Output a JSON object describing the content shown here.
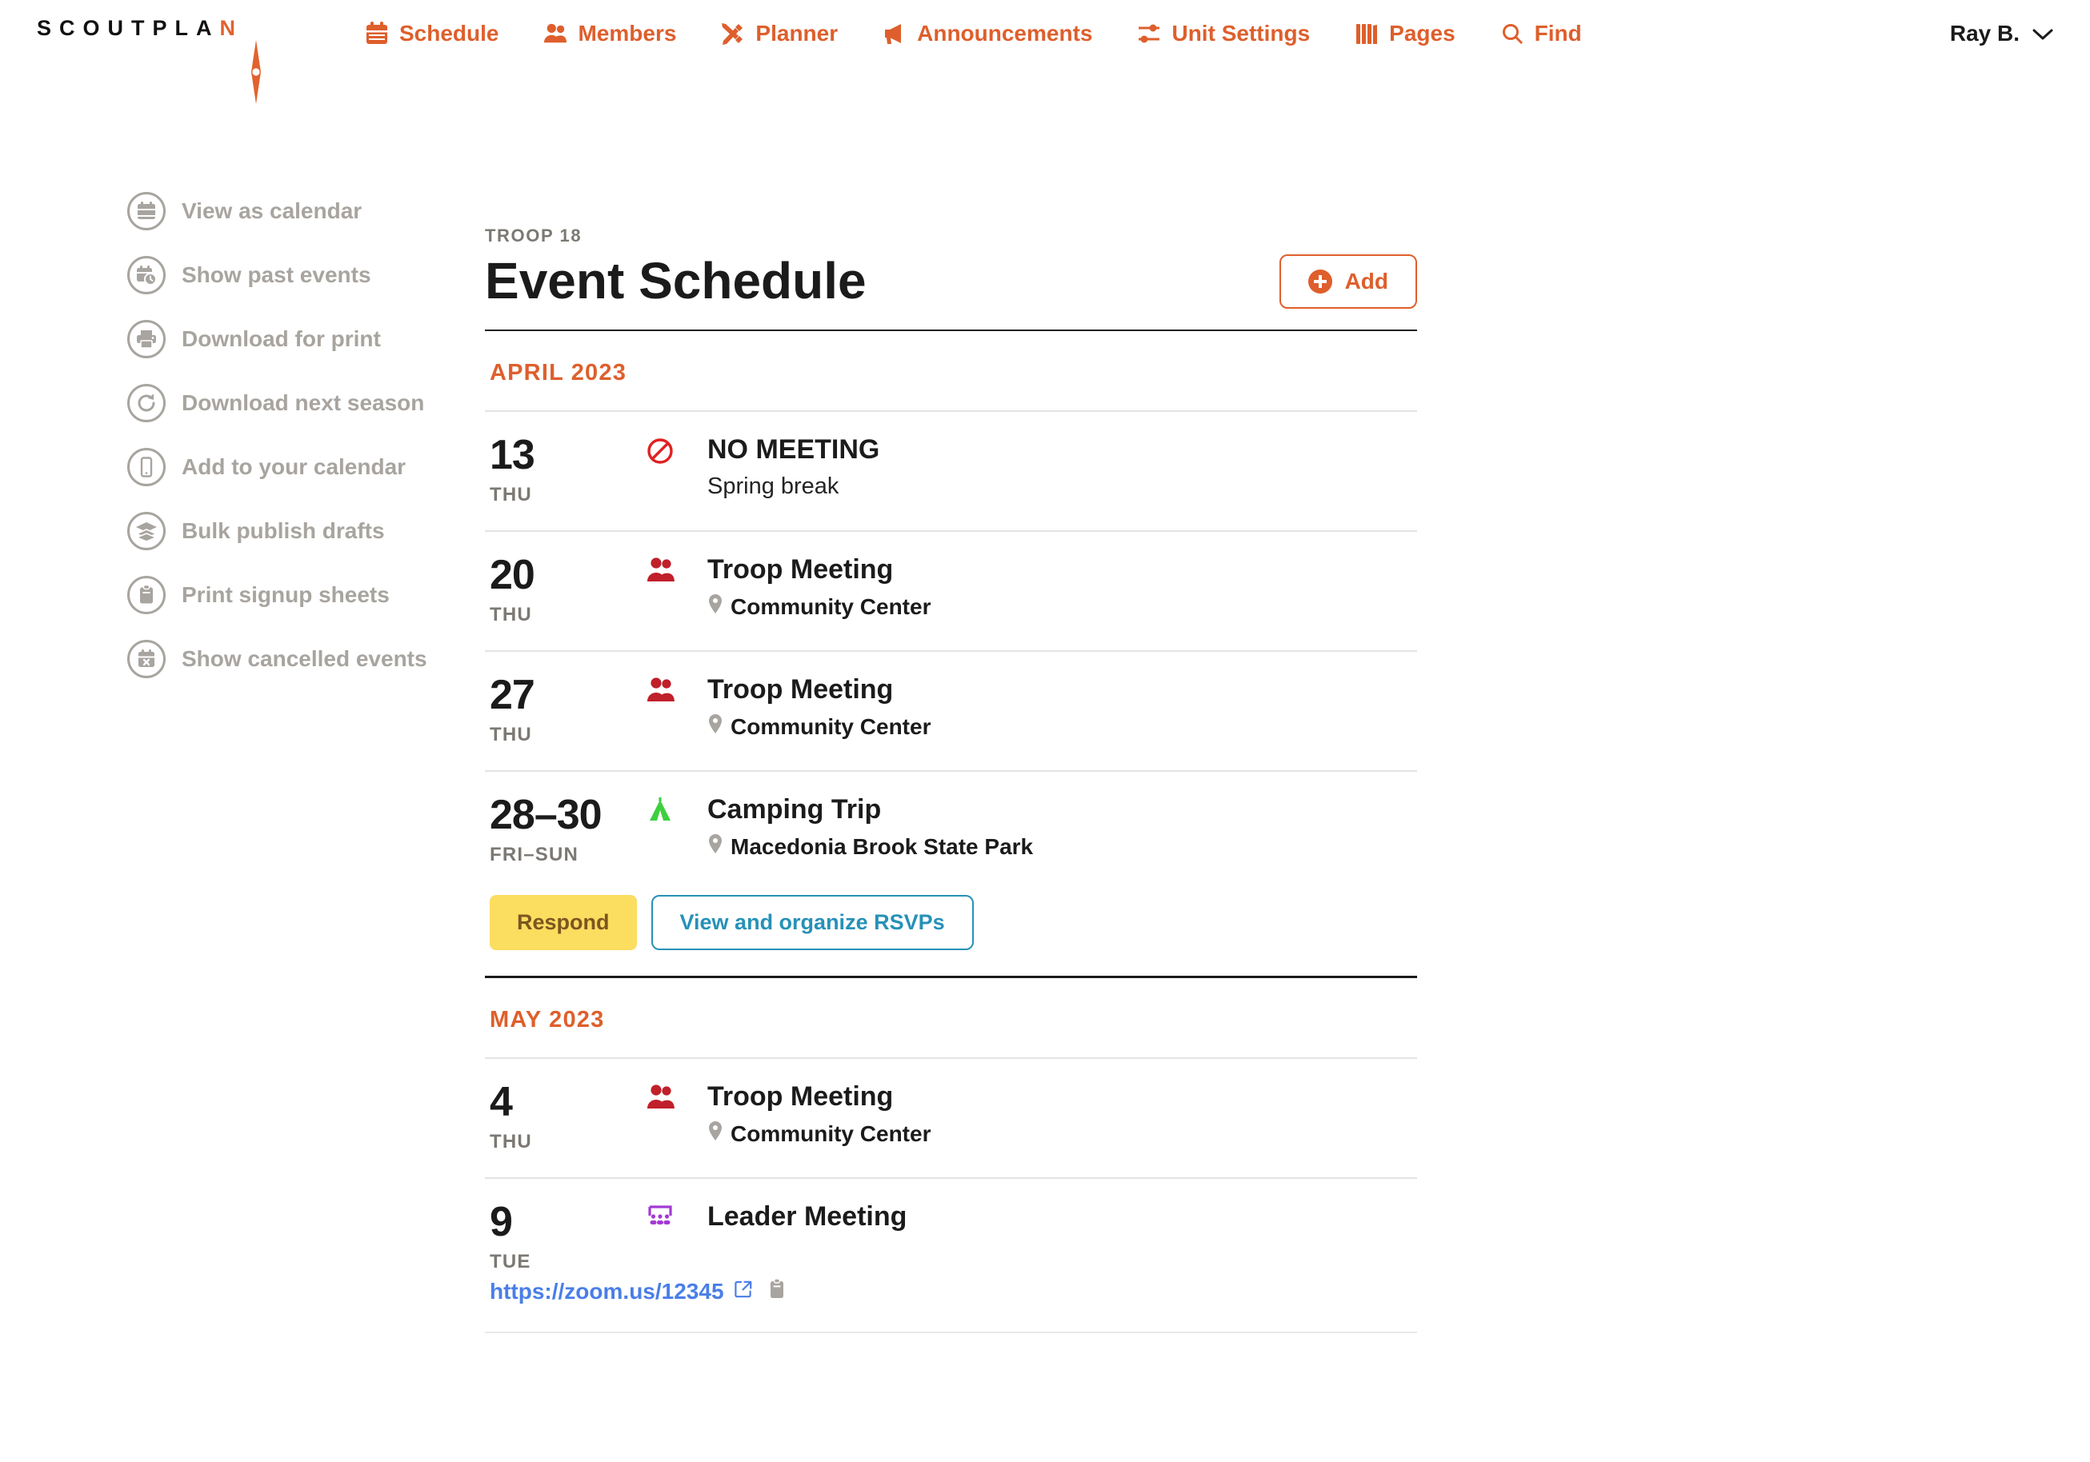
{
  "brand": {
    "name_main": "SCOUTPLA",
    "name_accent": "N",
    "logo_icon": "compass-needle-icon"
  },
  "nav": {
    "items": [
      {
        "label": "Schedule",
        "icon": "calendar-icon"
      },
      {
        "label": "Members",
        "icon": "users-icon"
      },
      {
        "label": "Planner",
        "icon": "pencil-ruler-icon"
      },
      {
        "label": "Announcements",
        "icon": "megaphone-icon"
      },
      {
        "label": "Unit Settings",
        "icon": "sliders-icon"
      },
      {
        "label": "Pages",
        "icon": "books-icon"
      },
      {
        "label": "Find",
        "icon": "search-icon"
      }
    ],
    "user": {
      "label": "Ray B.",
      "caret_icon": "chevron-down-icon"
    },
    "accent_color": "#de5f2c"
  },
  "sidebar": {
    "items": [
      {
        "label": "View as calendar",
        "icon": "calendar-icon"
      },
      {
        "label": "Show past events",
        "icon": "calendar-clock-icon"
      },
      {
        "label": "Download for print",
        "icon": "printer-icon"
      },
      {
        "label": "Download next season",
        "icon": "refresh-icon"
      },
      {
        "label": "Add to your calendar",
        "icon": "mobile-phone-icon"
      },
      {
        "label": "Bulk publish drafts",
        "icon": "layers-icon"
      },
      {
        "label": "Print signup sheets",
        "icon": "clipboard-icon"
      },
      {
        "label": "Show cancelled events",
        "icon": "calendar-x-icon"
      }
    ]
  },
  "header": {
    "eyebrow": "TROOP 18",
    "title": "Event Schedule",
    "add_label": "Add",
    "add_icon": "plus-circle-icon"
  },
  "months": [
    {
      "label": "APRIL 2023",
      "events": [
        {
          "day": "13",
          "dow": "THU",
          "icon": "no-entry-icon",
          "icon_color": "#e02020",
          "title": "NO MEETING",
          "sub": "Spring break",
          "sub_style": "plain"
        },
        {
          "day": "20",
          "dow": "THU",
          "icon": "users-icon",
          "icon_color": "#c0202a",
          "title": "Troop Meeting",
          "sub": "Community Center",
          "sub_style": "location",
          "location_icon": "map-pin-icon"
        },
        {
          "day": "27",
          "dow": "THU",
          "icon": "users-icon",
          "icon_color": "#c0202a",
          "title": "Troop Meeting",
          "sub": "Community Center",
          "sub_style": "location",
          "location_icon": "map-pin-icon"
        },
        {
          "day": "28–30",
          "dow": "FRI–SUN",
          "icon": "tent-icon",
          "icon_color": "#3ecf3e",
          "title": "Camping Trip",
          "sub": "Macedonia Brook State Park",
          "sub_style": "location",
          "location_icon": "map-pin-icon",
          "actions": [
            {
              "label": "Respond",
              "style": "respond"
            },
            {
              "label": "View and organize RSVPs",
              "style": "rsvp"
            }
          ]
        }
      ]
    },
    {
      "label": "MAY 2023",
      "events": [
        {
          "day": "4",
          "dow": "THU",
          "icon": "users-icon",
          "icon_color": "#c0202a",
          "title": "Troop Meeting",
          "sub": "Community Center",
          "sub_style": "location",
          "location_icon": "map-pin-icon"
        },
        {
          "day": "9",
          "dow": "TUE",
          "icon": "chalkboard-users-icon",
          "icon_color": "#a33ad4",
          "title": "Leader Meeting",
          "link": {
            "label": "https://zoom.us/12345",
            "external_icon": "external-link-icon",
            "copy_icon": "clipboard-copy-icon"
          }
        }
      ]
    }
  ],
  "colors": {
    "accent": "#de5f2c",
    "respond_bg": "#fbdd5f",
    "respond_text": "#7b5620",
    "rsvp": "#2791b7",
    "link": "#4a7ee8",
    "muted": "#a8a49f"
  }
}
